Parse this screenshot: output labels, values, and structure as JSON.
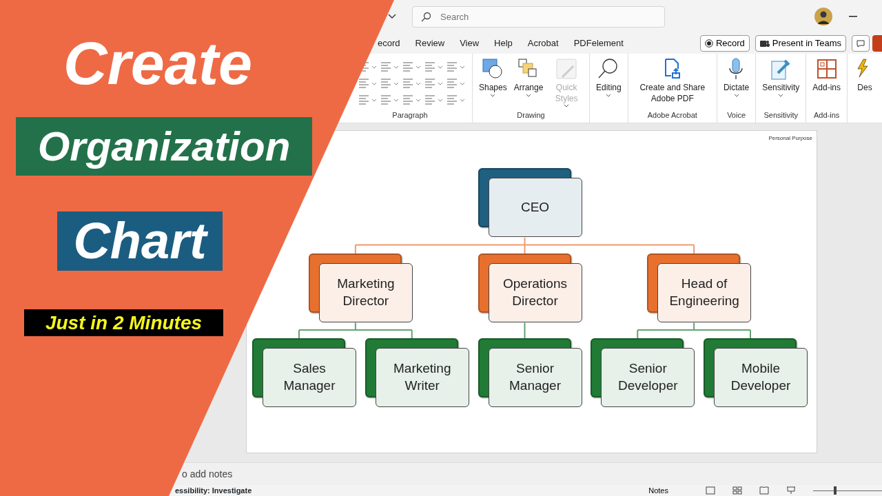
{
  "title_bar": {
    "search": {
      "placeholder": "Search"
    }
  },
  "tabs": [
    {
      "label": "ecord",
      "selected": false
    },
    {
      "label": "Review",
      "selected": false
    },
    {
      "label": "View",
      "selected": false
    },
    {
      "label": "Help",
      "selected": false
    },
    {
      "label": "Acrobat",
      "selected": false
    },
    {
      "label": "PDFelement",
      "selected": false
    }
  ],
  "header_buttons": [
    {
      "kind": "record",
      "label": "Record"
    },
    {
      "kind": "teams",
      "label": "Present in Teams"
    },
    {
      "kind": "comments"
    }
  ],
  "ribbon": {
    "groups": [
      {
        "kind": "paragraph",
        "label": "Paragraph"
      },
      {
        "kind": "drawing",
        "label": "Drawing",
        "buttons": [
          {
            "label": "Shapes",
            "disabled": false
          },
          {
            "label": "Arrange",
            "disabled": false
          },
          {
            "label": "Quick Styles",
            "disabled": true
          }
        ]
      },
      {
        "kind": "single",
        "buttons": [
          {
            "label": "Editing",
            "disabled": false
          }
        ]
      },
      {
        "kind": "single",
        "label": "Adobe Acrobat",
        "buttons": [
          {
            "label": "Create and Share Adobe PDF",
            "disabled": false
          }
        ]
      },
      {
        "kind": "single",
        "label": "Voice",
        "buttons": [
          {
            "label": "Dictate",
            "disabled": false
          }
        ]
      },
      {
        "kind": "single",
        "label": "Sensitivity",
        "buttons": [
          {
            "label": "Sensitivity",
            "disabled": false
          }
        ]
      },
      {
        "kind": "single",
        "label": "Add-ins",
        "buttons": [
          {
            "label": "Add-ins",
            "disabled": false
          }
        ]
      },
      {
        "kind": "cut",
        "buttons": [
          {
            "label": "Des",
            "disabled": false
          }
        ]
      }
    ]
  },
  "slide": {
    "corner_label": "Personal Purpose",
    "org_chart": {
      "label": "CEO",
      "color": "#1f5f80",
      "children": [
        {
          "label": "Marketing Director",
          "color": "#e8702e",
          "children": [
            {
              "label": "Sales Manager",
              "color": "#217a35"
            },
            {
              "label": "Marketing Writer",
              "color": "#217a35"
            }
          ]
        },
        {
          "label": "Operations Director",
          "color": "#e8702e",
          "children": [
            {
              "label": "Senior Manager",
              "color": "#217a35"
            }
          ]
        },
        {
          "label": "Head of Engineering",
          "color": "#e8702e",
          "children": [
            {
              "label": "Senior Developer",
              "color": "#217a35"
            },
            {
              "label": "Mobile Developer",
              "color": "#217a35"
            }
          ]
        }
      ]
    }
  },
  "notes_placeholder": "o add notes",
  "status_bar": {
    "accessibility": "essibility: Investigate",
    "notes_button": "Notes",
    "zoom": {
      "level": 0.3
    }
  },
  "overlay": {
    "title_lines": [
      {
        "text": "Create"
      },
      {
        "text": "Organization",
        "color": "#23714a"
      },
      {
        "text": "Chart",
        "color": "#1b5d80"
      }
    ],
    "tagline": "Just in 2 Minutes"
  }
}
